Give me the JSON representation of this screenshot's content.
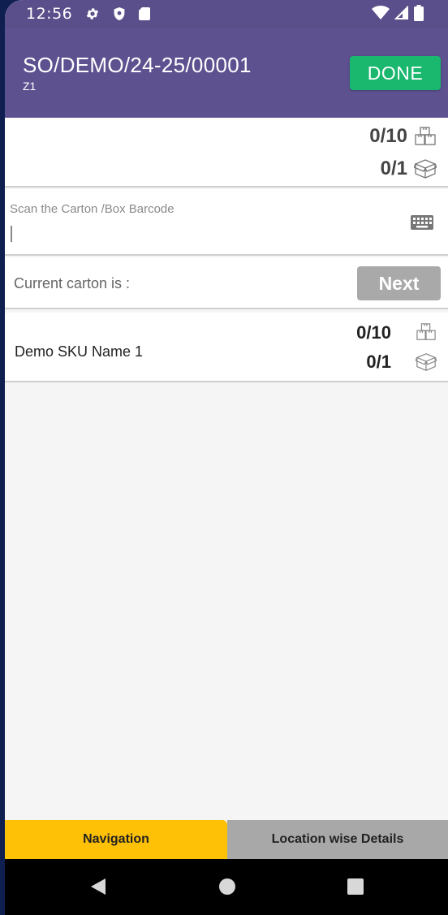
{
  "status_bar": {
    "time": "12:56",
    "left_icons": [
      "gear-icon",
      "shield-icon",
      "sd-card-icon"
    ],
    "right_icons": [
      "wifi-icon",
      "signal-icon",
      "battery-icon"
    ]
  },
  "header": {
    "title": "SO/DEMO/24-25/00001",
    "subtitle": "Z1",
    "done_label": "DONE"
  },
  "summary": {
    "pieces_qty": "0/10",
    "cartons_qty": "0/1"
  },
  "scan": {
    "label": "Scan the Carton /Box Barcode",
    "value": ""
  },
  "carton": {
    "label": "Current carton is :",
    "next_label": "Next"
  },
  "items": [
    {
      "name": "Demo SKU Name 1",
      "pieces_qty": "0/10",
      "cartons_qty": "0/1"
    }
  ],
  "tabs": [
    {
      "label": "Navigation",
      "active": true
    },
    {
      "label": "Location wise Details",
      "active": false
    }
  ],
  "colors": {
    "app_bar": "#5d5190",
    "status_bar": "#5a4f8a",
    "done_button": "#1ab76e",
    "next_button": "#a9a9a9",
    "active_tab": "#ffc106",
    "inactive_tab": "#a8a8a8"
  }
}
